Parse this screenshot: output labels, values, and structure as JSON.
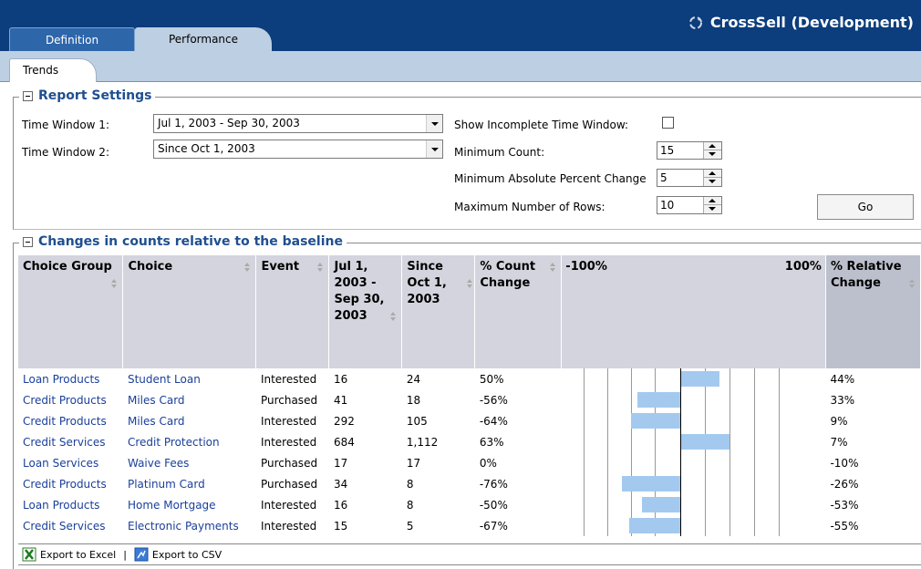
{
  "header": {
    "app_title": "CrossSell (Development)",
    "tabs": [
      "Definition",
      "Performance"
    ],
    "subtabs": [
      "Trends"
    ]
  },
  "report_settings": {
    "legend": "Report Settings",
    "time_window_1_label": "Time Window 1:",
    "time_window_1_value": "Jul 1, 2003 - Sep 30, 2003",
    "time_window_2_label": "Time Window 2:",
    "time_window_2_value": "Since Oct 1, 2003",
    "show_incomplete_label": "Show Incomplete Time Window:",
    "show_incomplete_checked": false,
    "min_count_label": "Minimum Count:",
    "min_count_value": "15",
    "min_abs_pct_label": "Minimum Absolute Percent Change",
    "min_abs_pct_value": "5",
    "max_rows_label": "Maximum Number of Rows:",
    "max_rows_value": "10",
    "go_label": "Go"
  },
  "changes": {
    "legend": "Changes in counts relative to the baseline",
    "headers": {
      "choice_group": "Choice Group",
      "choice": "Choice",
      "event": "Event",
      "window1": "Jul 1, 2003 - Sep 30, 2003",
      "window2": "Since Oct 1, 2003",
      "pct_count_change": "% Count Change",
      "chart_min": "-100%",
      "chart_max": "100%",
      "relative_change": "% Relative Change"
    },
    "rows": [
      {
        "group": "Loan Products",
        "choice": "Student Loan",
        "event": "Interested",
        "w1": "16",
        "w2": "24",
        "pct": "50%",
        "pct_value": 50,
        "rel": "44%"
      },
      {
        "group": "Credit Products",
        "choice": "Miles Card",
        "event": "Purchased",
        "w1": "41",
        "w2": "18",
        "pct": "-56%",
        "pct_value": -56,
        "rel": "33%"
      },
      {
        "group": "Credit Products",
        "choice": "Miles Card",
        "event": "Interested",
        "w1": "292",
        "w2": "105",
        "pct": "-64%",
        "pct_value": -64,
        "rel": "9%"
      },
      {
        "group": "Credit Services",
        "choice": "Credit Protection",
        "event": "Interested",
        "w1": "684",
        "w2": "1,112",
        "pct": "63%",
        "pct_value": 63,
        "rel": "7%"
      },
      {
        "group": "Loan Services",
        "choice": "Waive Fees",
        "event": "Purchased",
        "w1": "17",
        "w2": "17",
        "pct": "0%",
        "pct_value": 0,
        "rel": "-10%"
      },
      {
        "group": "Credit Products",
        "choice": "Platinum Card",
        "event": "Purchased",
        "w1": "34",
        "w2": "8",
        "pct": "-76%",
        "pct_value": -76,
        "rel": "-26%"
      },
      {
        "group": "Loan Products",
        "choice": "Home Mortgage",
        "event": "Interested",
        "w1": "16",
        "w2": "8",
        "pct": "-50%",
        "pct_value": -50,
        "rel": "-53%"
      },
      {
        "group": "Credit Services",
        "choice": "Electronic Payments",
        "event": "Interested",
        "w1": "15",
        "w2": "5",
        "pct": "-67%",
        "pct_value": -67,
        "rel": "-55%"
      }
    ]
  },
  "export": {
    "excel_label": "Export to Excel",
    "csv_label": "Export to CSV",
    "separator": "|"
  },
  "colors": {
    "header_bg": "#0c3d7c",
    "tab_bg": "#bdcfe3",
    "bar": "#a4c9ef",
    "link": "#1a3f9a",
    "legend": "#1f4f8f"
  }
}
